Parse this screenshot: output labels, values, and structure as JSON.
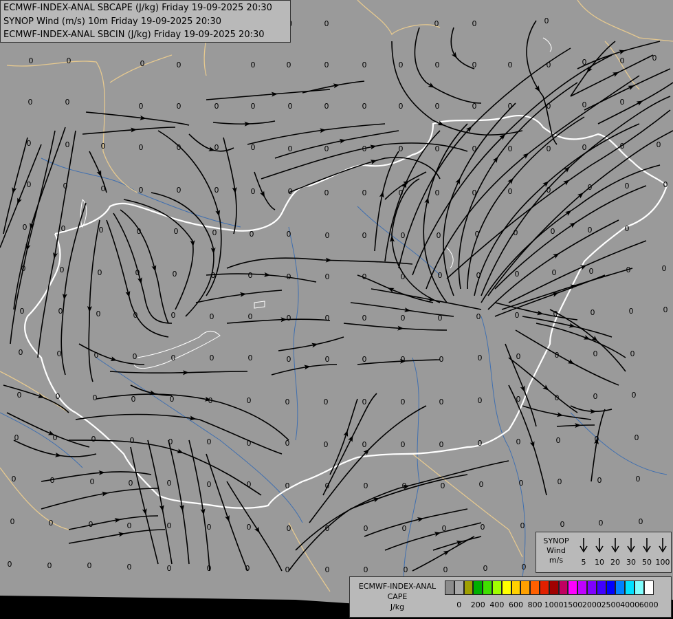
{
  "header": {
    "lines": [
      "ECMWF-INDEX-ANAL SBCAPE (J/kg) Friday 19-09-2025 20:30",
      "SYNOP Wind (m/s) 10m Friday 19-09-2025 20:30",
      "ECMWF-INDEX-ANAL SBCIN (J/kg) Friday 19-09-2025 20:30"
    ]
  },
  "map": {
    "station_value": "0",
    "colors": {
      "background": "#9a9a9a",
      "streamline": "#000000",
      "border_country": "#ffffff",
      "border_region": "#e6c98f",
      "river": "#3f6fb0"
    }
  },
  "wind_legend": {
    "title_lines": [
      "SYNOP",
      "Wind",
      "m/s"
    ],
    "values": [
      "5",
      "10",
      "20",
      "30",
      "50",
      "100"
    ]
  },
  "cape_legend": {
    "title_lines": [
      "ECMWF-INDEX-ANAL",
      "CAPE",
      "J/kg"
    ],
    "tick_labels": [
      "0",
      "200",
      "400",
      "600",
      "800",
      "1000",
      "1500",
      "2000",
      "2500",
      "4000",
      "6000"
    ],
    "colors": [
      "#8c8c8c",
      "#a8a8a8",
      "#a0a000",
      "#00b000",
      "#40e000",
      "#a0ff00",
      "#ffff00",
      "#ffd000",
      "#ffa000",
      "#ff6000",
      "#e02000",
      "#a00000",
      "#c00060",
      "#ff00ff",
      "#c000ff",
      "#8000ff",
      "#4000ff",
      "#0000ff",
      "#0080ff",
      "#00e0ff",
      "#80ffff",
      "#ffffff"
    ]
  }
}
